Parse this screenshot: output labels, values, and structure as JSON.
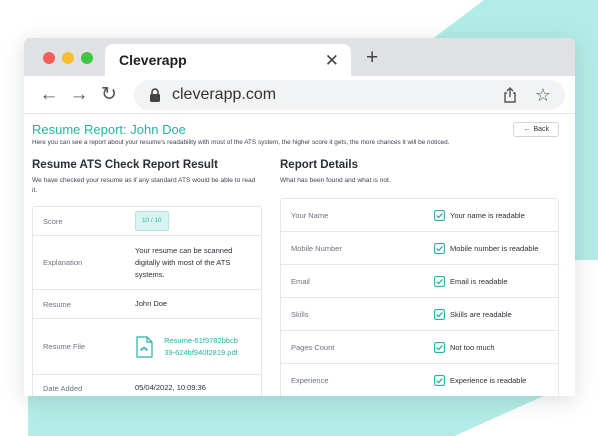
{
  "theme": {
    "accent": "#26b3a3",
    "background_shape": "#b3ece6"
  },
  "browser": {
    "tab_title": "Cleverapp",
    "url": "cleverapp.com",
    "icons": {
      "back": "back-arrow-icon",
      "forward": "forward-arrow-icon",
      "reload": "reload-icon",
      "lock": "lock-icon",
      "share": "share-icon",
      "bookmark": "star-icon",
      "close": "close-icon",
      "new_tab": "plus-icon"
    }
  },
  "header": {
    "title": "Resume Report: John Doe",
    "subtitle": "Here you can see a report about your resume's readability with most of the ATS system, the higher score it gets, the more chances it will be noticed.",
    "back_label": "Back"
  },
  "left": {
    "title": "Resume ATS Check Report Result",
    "description": "We have checked your resume as if any standard ATS would be able to read it.",
    "rows": {
      "score": {
        "label": "Score",
        "value": "10 / 10"
      },
      "explanation": {
        "label": "Explanation",
        "value": "Your resume can be scanned digitally with most of the ATS systems."
      },
      "resume": {
        "label": "Resume",
        "value": "John Doe"
      },
      "resume_file": {
        "label": "Resume File",
        "value": "Resume-61f9782bbcb39-624bf940f2819.pdf"
      },
      "date_added": {
        "label": "Date Added",
        "value": "05/04/2022, 10:09:36"
      }
    }
  },
  "right": {
    "title": "Report Details",
    "description": "What has been found and what is not.",
    "items": [
      {
        "label": "Your Name",
        "status": "Your name is readable"
      },
      {
        "label": "Mobile Number",
        "status": "Mobile number is readable"
      },
      {
        "label": "Email",
        "status": "Email is readable"
      },
      {
        "label": "Skills",
        "status": "Skills are readable"
      },
      {
        "label": "Pages Count",
        "status": "Not too much"
      },
      {
        "label": "Experience",
        "status": "Experience is readable"
      }
    ]
  }
}
